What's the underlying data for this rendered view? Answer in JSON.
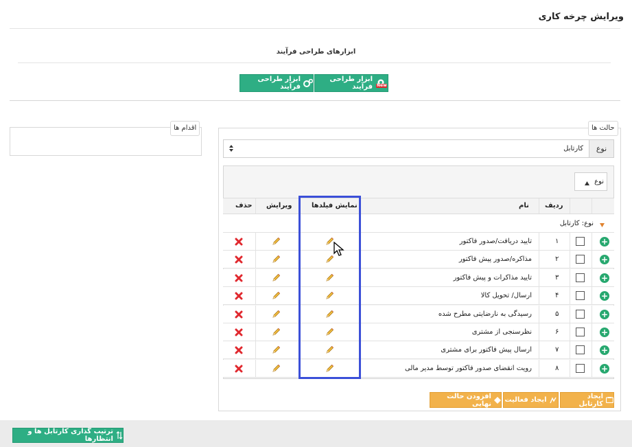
{
  "page": {
    "title": "ویرایش چرخه کاری",
    "tools_section_title": "ابزارهای طراحی فرآیند",
    "tool_button_new": "ابزار طراحی فرآیند",
    "tool_button_new_badge": "New",
    "tool_button_old": "ابزار طراحی فرآیند"
  },
  "actions_panel": {
    "legend": "اقدام ها"
  },
  "states_panel": {
    "legend": "حالت ها",
    "type_label": "نوع",
    "type_value": "کارتابل",
    "group_chip_label": "نوع",
    "columns": {
      "row_no": "ردیف",
      "name": "نام",
      "show_fields": "نمایش فیلدها",
      "edit": "ویرایش",
      "delete": "حذف"
    },
    "group_header": "نوع: کارتابل",
    "rows": [
      {
        "no": "۱",
        "name": "تایید دریافت/صدور فاکتور"
      },
      {
        "no": "۲",
        "name": "مذاکره/صدور پیش فاکتور"
      },
      {
        "no": "۳",
        "name": "تایید مذاکرات و پیش فاکتور"
      },
      {
        "no": "۴",
        "name": "ارسال/ تحویل کالا"
      },
      {
        "no": "۵",
        "name": "رسیدگی به نارضایتی مطرح شده"
      },
      {
        "no": "۶",
        "name": "نظرسنجی از مشتری"
      },
      {
        "no": "۷",
        "name": "ارسال پیش فاکتور برای مشتری"
      },
      {
        "no": "۸",
        "name": "رویت انقضای صدور فاکتور توسط مدیر مالی"
      }
    ],
    "buttons": {
      "create_cartable": "ایجاد کارتابل",
      "create_activity": "ایجاد فعالیت",
      "add_final_state": "افزودن حالت نهایی"
    }
  },
  "footer": {
    "sort_button": "ترتیب گذاری کارتابل ها و انتظارها"
  },
  "colors": {
    "green": "#2eae84",
    "orange": "#f2b24b",
    "highlight": "#3b4fd8",
    "delete_red": "#e0282e"
  }
}
